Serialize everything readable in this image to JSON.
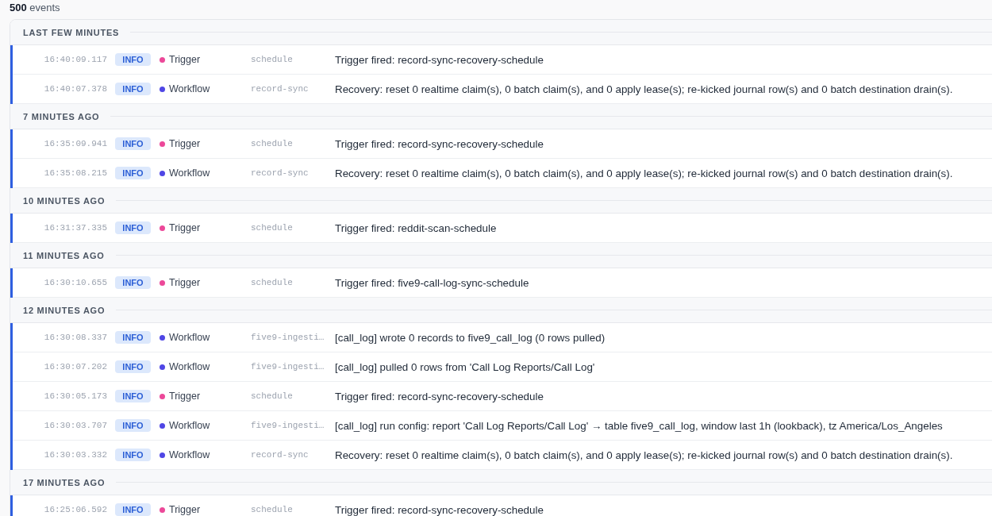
{
  "event_count": "**500** events",
  "groups": [
    {
      "title": "LAST FEW MINUTES",
      "events": [
        {
          "time": "16:40:09.117",
          "level": "INFO",
          "kind": "info",
          "source": "Trigger",
          "color": "#ec4899",
          "origin": "schedule",
          "message": "Trigger fired: record-sync-recovery-schedule"
        },
        {
          "time": "16:40:07.378",
          "level": "INFO",
          "kind": "info",
          "source": "Workflow",
          "color": "#4f46e5",
          "origin": "record-sync",
          "message": "Recovery: reset 0 realtime claim(s), 0 batch claim(s), and 0 apply lease(s); re-kicked journal row(s) and 0 batch destination drain(s)."
        }
      ]
    },
    {
      "title": "7 MINUTES AGO",
      "events": [
        {
          "time": "16:35:09.941",
          "level": "INFO",
          "kind": "info",
          "source": "Trigger",
          "color": "#ec4899",
          "origin": "schedule",
          "message": "Trigger fired: record-sync-recovery-schedule"
        },
        {
          "time": "16:35:08.215",
          "level": "INFO",
          "kind": "info",
          "source": "Workflow",
          "color": "#4f46e5",
          "origin": "record-sync",
          "message": "Recovery: reset 0 realtime claim(s), 0 batch claim(s), and 0 apply lease(s); re-kicked journal row(s) and 0 batch destination drain(s)."
        }
      ]
    },
    {
      "title": "10 MINUTES AGO",
      "events": [
        {
          "time": "16:31:37.335",
          "level": "INFO",
          "kind": "info",
          "source": "Trigger",
          "color": "#ec4899",
          "origin": "schedule",
          "message": "Trigger fired: reddit-scan-schedule"
        }
      ]
    },
    {
      "title": "11 MINUTES AGO",
      "events": [
        {
          "time": "16:30:10.655",
          "level": "INFO",
          "kind": "info",
          "source": "Trigger",
          "color": "#ec4899",
          "origin": "schedule",
          "message": "Trigger fired: five9-call-log-sync-schedule"
        }
      ]
    },
    {
      "title": "12 MINUTES AGO",
      "events": [
        {
          "time": "16:30:08.337",
          "level": "INFO",
          "kind": "info",
          "source": "Workflow",
          "color": "#4f46e5",
          "origin": "five9-ingesti…",
          "message": "[call_log] wrote 0 records to five9_call_log (0 rows pulled)"
        },
        {
          "time": "16:30:07.202",
          "level": "INFO",
          "kind": "info",
          "source": "Workflow",
          "color": "#4f46e5",
          "origin": "five9-ingesti…",
          "message": "[call_log] pulled 0 rows from 'Call Log Reports/Call Log'"
        },
        {
          "time": "16:30:05.173",
          "level": "INFO",
          "kind": "info",
          "source": "Trigger",
          "color": "#ec4899",
          "origin": "schedule",
          "message": "Trigger fired: record-sync-recovery-schedule"
        },
        {
          "time": "16:30:03.707",
          "level": "INFO",
          "kind": "info",
          "source": "Workflow",
          "color": "#4f46e5",
          "origin": "five9-ingesti…",
          "message": "[call_log] run config: report 'Call Log Reports/Call Log' → table five9_call_log, window last 1h (lookback), tz America/Los_Angeles"
        },
        {
          "time": "16:30:03.332",
          "level": "INFO",
          "kind": "info",
          "source": "Workflow",
          "color": "#4f46e5",
          "origin": "record-sync",
          "message": "Recovery: reset 0 realtime claim(s), 0 batch claim(s), and 0 apply lease(s); re-kicked journal row(s) and 0 batch destination drain(s)."
        }
      ]
    },
    {
      "title": "17 MINUTES AGO",
      "events": [
        {
          "time": "16:25:06.592",
          "level": "INFO",
          "kind": "info",
          "source": "Trigger",
          "color": "#ec4899",
          "origin": "schedule",
          "message": "Trigger fired: record-sync-recovery-schedule"
        }
      ]
    }
  ]
}
